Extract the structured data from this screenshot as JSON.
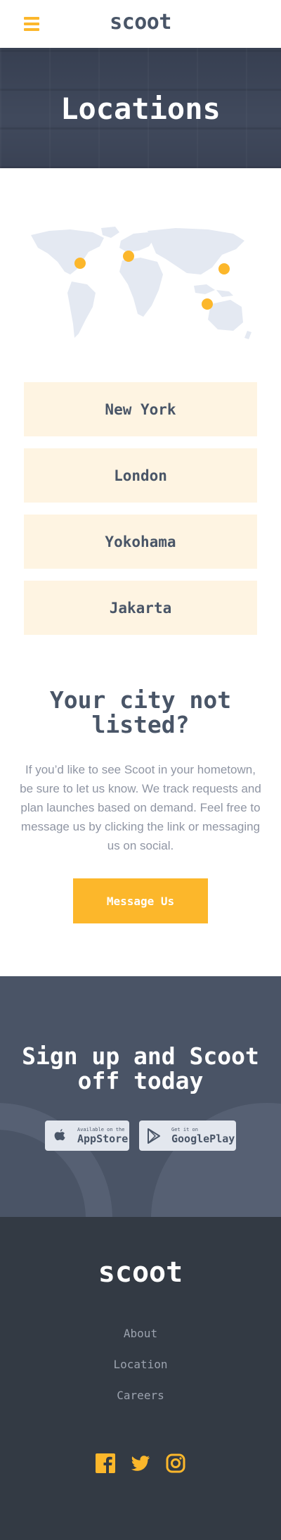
{
  "header": {
    "logo": "scoot",
    "menu_icon": "hamburger-icon"
  },
  "hero": {
    "title": "Locations"
  },
  "locations": [
    "New York",
    "London",
    "Yokohama",
    "Jakarta"
  ],
  "cta": {
    "title_line1": "Your city not",
    "title_line2": "listed?",
    "text": "If you’d like to see Scoot in your hometown, be sure to let us know. We track requests and plan launches based on demand. Feel free to message us by clicking the link or messaging us on social.",
    "button": "Message Us"
  },
  "signup": {
    "title_line1": "Sign up and Scoot",
    "title_line2": "off today",
    "appstore": {
      "small": "Available on the",
      "big": "AppStore",
      "icon": "apple-icon"
    },
    "googleplay": {
      "small": "Get it on",
      "big": "GooglePlay",
      "icon": "play-store-icon"
    }
  },
  "footer": {
    "logo": "scoot",
    "links": [
      "About",
      "Location",
      "Careers"
    ],
    "social_icons": [
      "facebook-icon",
      "twitter-icon",
      "instagram-icon"
    ]
  },
  "colors": {
    "accent": "#FCB72B",
    "dark": "#495567",
    "card_bg": "#FEF4E2",
    "footer_bg": "#333A44",
    "signup_bg": "#4A5466"
  }
}
